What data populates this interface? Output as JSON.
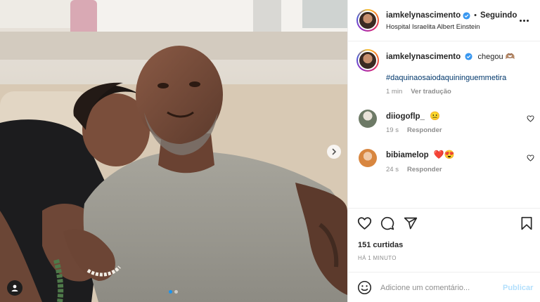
{
  "post": {
    "photo_alt_icons": {
      "next": "chevron-right-icon",
      "tag": "user-tag-icon"
    },
    "carousel": {
      "count": 2,
      "active": 1
    }
  },
  "header": {
    "username": "iamkelynascimento",
    "separator": "•",
    "follow_state": "Seguindo",
    "location": "Hospital Israelita Albert Einstein",
    "more_icon": "more-horizontal-icon"
  },
  "caption": {
    "username": "iamkelynascimento",
    "text": "chegou 🫶🏽",
    "hashtag": "#daquinaosaiodaquininguemmetira",
    "time": "1 min",
    "translate": "Ver tradução"
  },
  "comments": [
    {
      "username": "diiogoflp_",
      "text": "😐",
      "time": "19 s",
      "reply": "Responder"
    },
    {
      "username": "bibiamelop",
      "text": "❤️😍",
      "time": "24 s",
      "reply": "Responder"
    }
  ],
  "actions": {
    "icons": [
      "heart-icon",
      "comment-icon",
      "share-icon",
      "bookmark-icon"
    ],
    "likes": "151 curtidas",
    "posted": "HÁ 1 MINUTO"
  },
  "composer": {
    "placeholder": "Adicione um comentário...",
    "publish": "Publicar",
    "emoji_icon": "emoji-icon"
  },
  "colors": {
    "verified": "#3897f0",
    "link": "#00376b",
    "muted": "#8e8e8e",
    "publish_disabled": "#b2dffc",
    "carousel_active": "#1a95f0"
  }
}
